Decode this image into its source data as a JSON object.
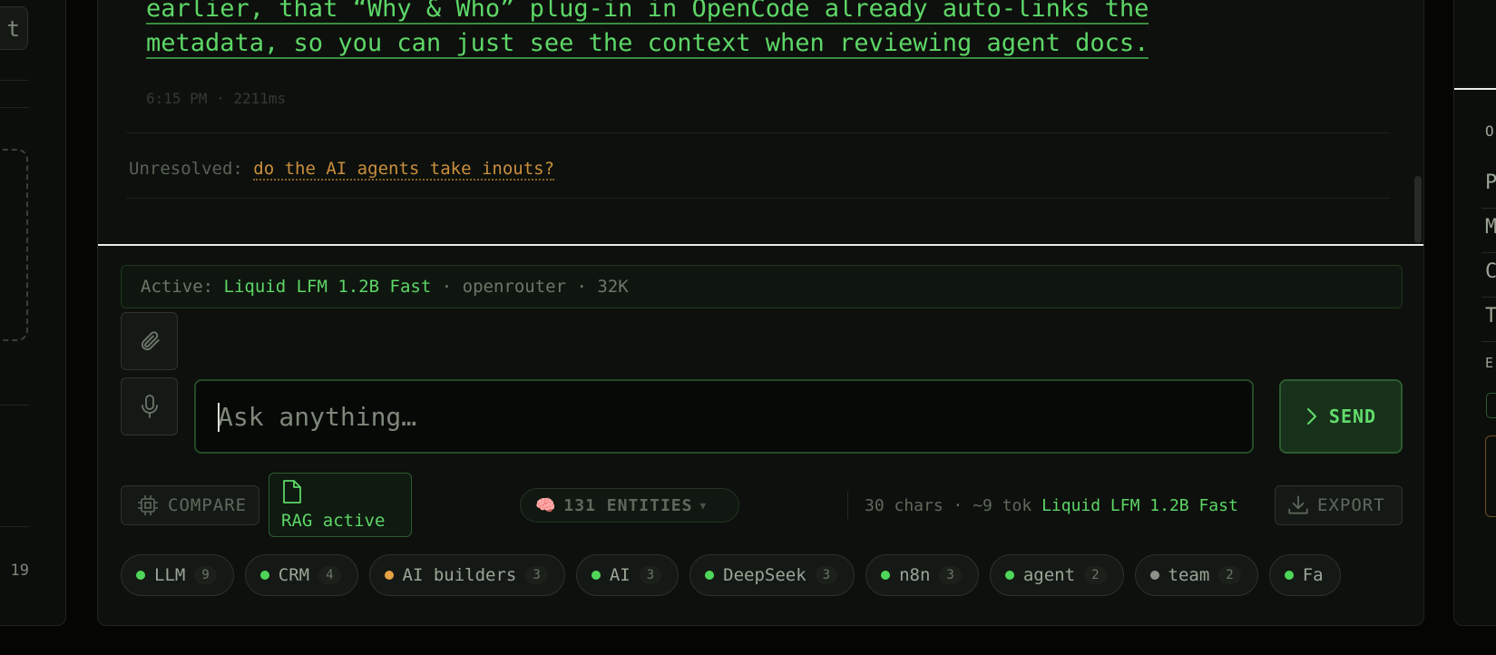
{
  "left_panel": {
    "button_fragment": "t",
    "count_fragment": ") 19"
  },
  "message": {
    "line1": "earlier, that “Why & Who” plug-in in OpenCode already auto-links the",
    "line2": "metadata, so you can just see the context when reviewing agent docs.",
    "meta": "6:15 PM · 2211ms"
  },
  "unresolved": {
    "label": "Unresolved:",
    "link": "do the AI agents take inouts?"
  },
  "active_model": {
    "prefix": "Active:",
    "model": "Liquid LFM 1.2B Fast",
    "provider": "· openrouter · 32K"
  },
  "input": {
    "placeholder": "Ask anything…",
    "value": ""
  },
  "send_label": "SEND",
  "compare_label": "COMPARE",
  "rag_label": "RAG active",
  "entities_label": "131 ENTITIES",
  "stats": {
    "counts": "30 chars · ~9 tok",
    "model": "Liquid LFM 1.2B Fast"
  },
  "export_label": "EXPORT",
  "tags": [
    {
      "name": "LLM",
      "count": "9",
      "color": "#4fd65a"
    },
    {
      "name": "CRM",
      "count": "4",
      "color": "#4fd65a"
    },
    {
      "name": "AI builders",
      "count": "3",
      "color": "#e6a245"
    },
    {
      "name": "AI",
      "count": "3",
      "color": "#4fd65a"
    },
    {
      "name": "DeepSeek",
      "count": "3",
      "color": "#4fd65a"
    },
    {
      "name": "n8n",
      "count": "3",
      "color": "#4fd65a"
    },
    {
      "name": "agent",
      "count": "2",
      "color": "#4fd65a"
    },
    {
      "name": "team",
      "count": "2",
      "color": "#8c928a"
    },
    {
      "name": "Fa",
      "count": "",
      "color": "#4fd65a"
    }
  ],
  "right_panel": {
    "letters": [
      "O",
      "P",
      "M",
      "C",
      "T",
      "E"
    ]
  },
  "colors": {
    "accent": "#5dd667",
    "warning": "#c98f3e",
    "background": "#0d100c"
  }
}
